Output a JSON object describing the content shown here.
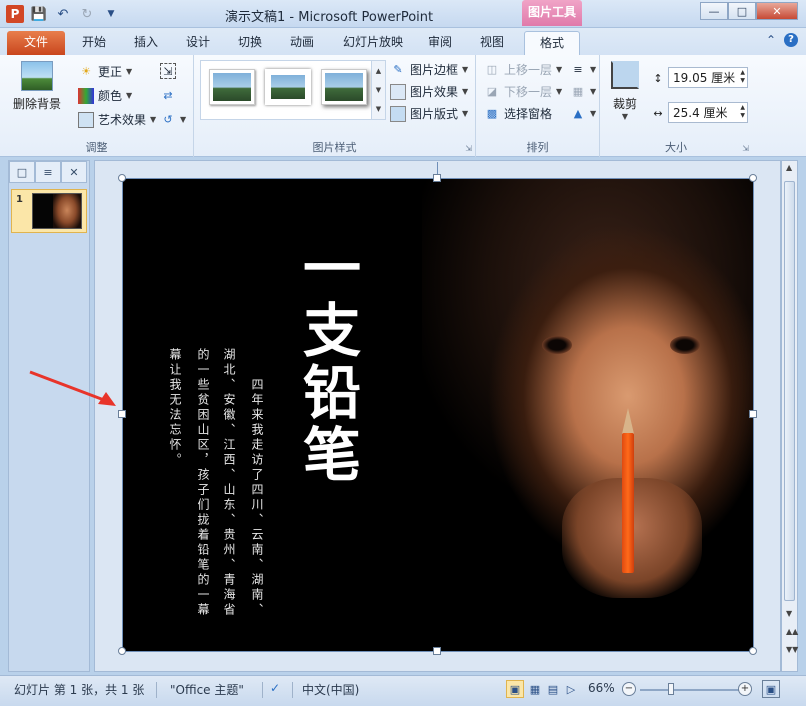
{
  "window": {
    "title": "演示文稿1 - Microsoft PowerPoint",
    "tool_context": "图片工具"
  },
  "quick_access": {
    "icons": [
      "powerpoint-app-icon",
      "save-icon",
      "undo-icon",
      "redo-icon",
      "customize-icon"
    ]
  },
  "tabs": [
    {
      "label": "文件"
    },
    {
      "label": "开始"
    },
    {
      "label": "插入"
    },
    {
      "label": "设计"
    },
    {
      "label": "切换"
    },
    {
      "label": "动画"
    },
    {
      "label": "幻灯片放映"
    },
    {
      "label": "审阅"
    },
    {
      "label": "视图"
    },
    {
      "label": "格式"
    }
  ],
  "ribbon": {
    "adjust": {
      "remove_bg": "删除背景",
      "corrections": "更正",
      "color": "颜色",
      "artistic": "艺术效果",
      "label": "调整"
    },
    "picture_styles": {
      "border": "图片边框",
      "effects": "图片效果",
      "layout": "图片版式",
      "label": "图片样式"
    },
    "arrange": {
      "bring_forward": "上移一层",
      "send_backward": "下移一层",
      "selection_pane": "选择窗格",
      "label": "排列"
    },
    "size": {
      "crop": "裁剪",
      "height": "19.05 厘米",
      "width": "25.4 厘米",
      "label": "大小"
    }
  },
  "slide_panel": {
    "slide_number": "1"
  },
  "slide": {
    "title_chars": "一支铅笔",
    "columns": [
      "四年来我走访了四川、云南、湖南、",
      "湖北、安徽、江西、山东、贵州、青海省",
      "的一些贫困山区，孩子们拢着铅笔的一幕",
      "幕让我无法忘怀。"
    ]
  },
  "status": {
    "slide_info": "幻灯片 第 1 张，共 1 张",
    "theme": "\"Office 主题\"",
    "language": "中文(中国)",
    "zoom": "66%"
  }
}
